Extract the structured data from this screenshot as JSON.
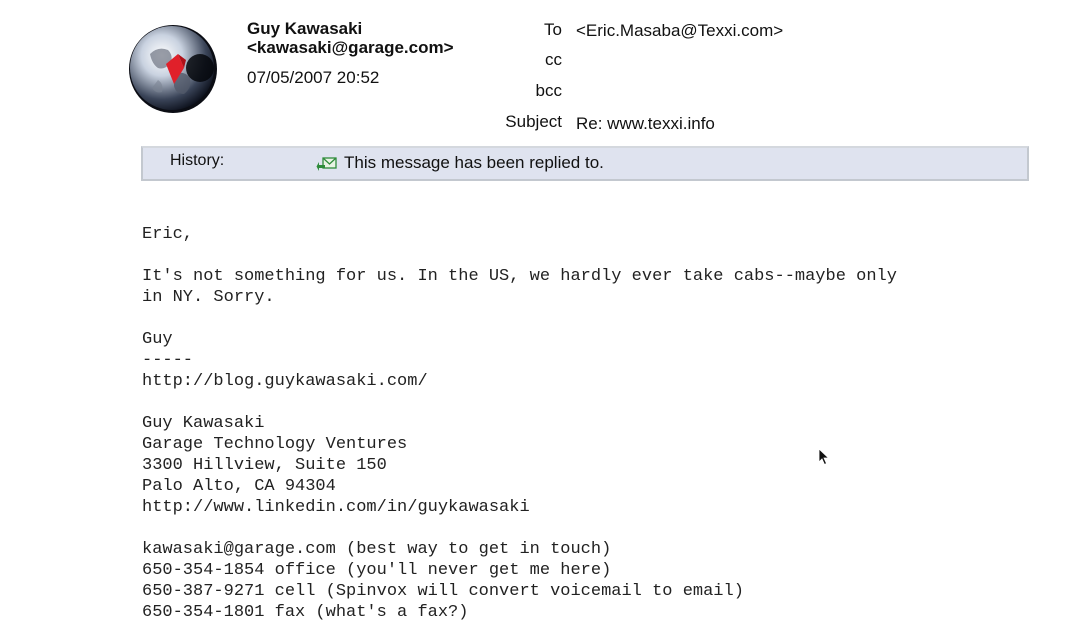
{
  "sender": {
    "name": "Guy Kawasaki",
    "email": "<kawasaki@garage.com>",
    "date": "07/05/2007 20:52",
    "avatar_icon": "globe-avatar-icon"
  },
  "headers": {
    "to_label": "To",
    "to_value": "<Eric.Masaba@Texxi.com>",
    "cc_label": "cc",
    "cc_value": "",
    "bcc_label": "bcc",
    "bcc_value": "",
    "subject_label": "Subject",
    "subject_value": "Re: www.texxi.info"
  },
  "history": {
    "label": "History:",
    "icon": "replied-envelope-icon",
    "text": "This message has been replied to."
  },
  "body": {
    "lines": [
      "Eric,",
      "",
      "It's not something for us. In the US, we hardly ever take cabs--maybe only",
      "in NY. Sorry.",
      "",
      "Guy",
      "-----",
      "http://blog.guykawasaki.com/",
      "",
      "Guy Kawasaki",
      "Garage Technology Ventures",
      "3300 Hillview, Suite 150",
      "Palo Alto, CA 94304",
      "http://www.linkedin.com/in/guykawasaki",
      "",
      "kawasaki@garage.com (best way to get in touch)",
      "650-354-1854 office (you'll never get me here)",
      "650-387-9271 cell (Spinvox will convert voicemail to email)",
      "650-354-1801 fax (what's a fax?)"
    ]
  },
  "colors": {
    "history_bg": "#dfe3ef",
    "history_border": "#c3c8cf",
    "replied_icon": "#2e8b3a"
  }
}
